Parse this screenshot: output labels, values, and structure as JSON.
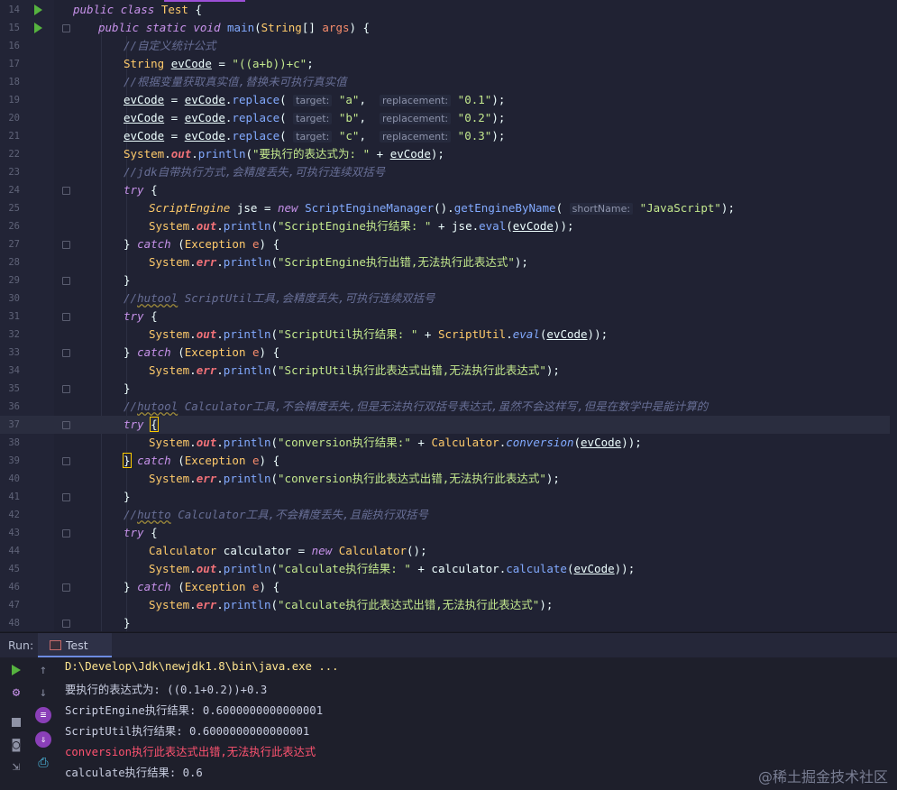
{
  "editor": {
    "lines": [
      {
        "n": "14",
        "run": true,
        "fold": false,
        "indent": 0,
        "tokens": [
          [
            "kw",
            "public "
          ],
          [
            "kw",
            "class "
          ],
          [
            "cls",
            "Test "
          ],
          [
            "plain",
            "{"
          ]
        ]
      },
      {
        "n": "15",
        "run": true,
        "fold": true,
        "indent": 1,
        "tokens": [
          [
            "kw",
            "public "
          ],
          [
            "kw",
            "static "
          ],
          [
            "kw",
            "void "
          ],
          [
            "fn",
            "main"
          ],
          [
            "plain",
            "("
          ],
          [
            "cls",
            "String"
          ],
          [
            "plain",
            "[] "
          ],
          [
            "param",
            "args"
          ],
          [
            "plain",
            ") {"
          ]
        ]
      },
      {
        "n": "16",
        "indent": 2,
        "tokens": [
          [
            "cmt",
            "//自定义统计公式"
          ]
        ]
      },
      {
        "n": "17",
        "indent": 2,
        "tokens": [
          [
            "cls",
            "String "
          ],
          [
            "var",
            "evCode"
          ],
          [
            "plain",
            " = "
          ],
          [
            "str",
            "\"((a+b))+c\""
          ],
          [
            "plain",
            ";"
          ]
        ]
      },
      {
        "n": "18",
        "indent": 2,
        "tokens": [
          [
            "cmt",
            "//根据变量获取真实值,替换未可执行真实值"
          ]
        ]
      },
      {
        "n": "19",
        "indent": 2,
        "tokens": [
          [
            "var",
            "evCode"
          ],
          [
            "plain",
            " = "
          ],
          [
            "var",
            "evCode"
          ],
          [
            "plain",
            "."
          ],
          [
            "fn",
            "replace"
          ],
          [
            "plain",
            "( "
          ],
          [
            "hint",
            "target:"
          ],
          [
            "plain",
            " "
          ],
          [
            "str",
            "\"a\""
          ],
          [
            "plain",
            ",  "
          ],
          [
            "hint",
            "replacement:"
          ],
          [
            "plain",
            " "
          ],
          [
            "str",
            "\"0.1\""
          ],
          [
            "plain",
            ");"
          ]
        ]
      },
      {
        "n": "20",
        "indent": 2,
        "tokens": [
          [
            "var",
            "evCode"
          ],
          [
            "plain",
            " = "
          ],
          [
            "var",
            "evCode"
          ],
          [
            "plain",
            "."
          ],
          [
            "fn",
            "replace"
          ],
          [
            "plain",
            "( "
          ],
          [
            "hint",
            "target:"
          ],
          [
            "plain",
            " "
          ],
          [
            "str",
            "\"b\""
          ],
          [
            "plain",
            ",  "
          ],
          [
            "hint",
            "replacement:"
          ],
          [
            "plain",
            " "
          ],
          [
            "str",
            "\"0.2\""
          ],
          [
            "plain",
            ");"
          ]
        ]
      },
      {
        "n": "21",
        "indent": 2,
        "tokens": [
          [
            "var",
            "evCode"
          ],
          [
            "plain",
            " = "
          ],
          [
            "var",
            "evCode"
          ],
          [
            "plain",
            "."
          ],
          [
            "fn",
            "replace"
          ],
          [
            "plain",
            "( "
          ],
          [
            "hint",
            "target:"
          ],
          [
            "plain",
            " "
          ],
          [
            "str",
            "\"c\""
          ],
          [
            "plain",
            ",  "
          ],
          [
            "hint",
            "replacement:"
          ],
          [
            "plain",
            " "
          ],
          [
            "str",
            "\"0.3\""
          ],
          [
            "plain",
            ");"
          ]
        ]
      },
      {
        "n": "22",
        "indent": 2,
        "tokens": [
          [
            "cls",
            "System"
          ],
          [
            "plain",
            "."
          ],
          [
            "fld",
            "out"
          ],
          [
            "plain",
            "."
          ],
          [
            "fn",
            "println"
          ],
          [
            "plain",
            "("
          ],
          [
            "str",
            "\"要执行的表达式为: \""
          ],
          [
            "plain",
            " + "
          ],
          [
            "var",
            "evCode"
          ],
          [
            "plain",
            ");"
          ]
        ]
      },
      {
        "n": "23",
        "indent": 2,
        "tokens": [
          [
            "cmt",
            "//jdk自带执行方式,会精度丢失,可执行连续双括号"
          ]
        ]
      },
      {
        "n": "24",
        "fold": true,
        "indent": 2,
        "tokens": [
          [
            "kw",
            "try "
          ],
          [
            "plain",
            "{"
          ]
        ]
      },
      {
        "n": "25",
        "indent": 3,
        "tokens": [
          [
            "clsi",
            "ScriptEngine "
          ],
          [
            "plain",
            "jse = "
          ],
          [
            "kw",
            "new "
          ],
          [
            "fn",
            "ScriptEngineManager"
          ],
          [
            "plain",
            "()."
          ],
          [
            "fn",
            "getEngineByName"
          ],
          [
            "plain",
            "( "
          ],
          [
            "hint",
            "shortName:"
          ],
          [
            "plain",
            " "
          ],
          [
            "str",
            "\"JavaScript\""
          ],
          [
            "plain",
            ");"
          ]
        ]
      },
      {
        "n": "26",
        "indent": 3,
        "tokens": [
          [
            "cls",
            "System"
          ],
          [
            "plain",
            "."
          ],
          [
            "fld",
            "out"
          ],
          [
            "plain",
            "."
          ],
          [
            "fn",
            "println"
          ],
          [
            "plain",
            "("
          ],
          [
            "str",
            "\"ScriptEngine执行结果: \""
          ],
          [
            "plain",
            " + jse."
          ],
          [
            "fn",
            "eval"
          ],
          [
            "plain",
            "("
          ],
          [
            "var",
            "evCode"
          ],
          [
            "plain",
            "));"
          ]
        ]
      },
      {
        "n": "27",
        "fold": true,
        "indent": 2,
        "tokens": [
          [
            "plain",
            "} "
          ],
          [
            "kw",
            "catch "
          ],
          [
            "plain",
            "("
          ],
          [
            "cls",
            "Exception "
          ],
          [
            "param",
            "e"
          ],
          [
            "plain",
            ") {"
          ]
        ]
      },
      {
        "n": "28",
        "indent": 3,
        "tokens": [
          [
            "cls",
            "System"
          ],
          [
            "plain",
            "."
          ],
          [
            "fld",
            "err"
          ],
          [
            "plain",
            "."
          ],
          [
            "fn",
            "println"
          ],
          [
            "plain",
            "("
          ],
          [
            "str",
            "\"ScriptEngine执行出错,无法执行此表达式\""
          ],
          [
            "plain",
            ");"
          ]
        ]
      },
      {
        "n": "29",
        "fold": true,
        "indent": 2,
        "tokens": [
          [
            "plain",
            "}"
          ]
        ]
      },
      {
        "n": "30",
        "indent": 2,
        "tokens": [
          [
            "cmt",
            "//"
          ],
          [
            "cmtw",
            "hutool"
          ],
          [
            "cmt",
            " ScriptUtil工具,会精度丢失,可执行连续双括号"
          ]
        ]
      },
      {
        "n": "31",
        "fold": true,
        "indent": 2,
        "tokens": [
          [
            "kw",
            "try "
          ],
          [
            "plain",
            "{"
          ]
        ]
      },
      {
        "n": "32",
        "indent": 3,
        "tokens": [
          [
            "cls",
            "System"
          ],
          [
            "plain",
            "."
          ],
          [
            "fld",
            "out"
          ],
          [
            "plain",
            "."
          ],
          [
            "fn",
            "println"
          ],
          [
            "plain",
            "("
          ],
          [
            "str",
            "\"ScriptUtil执行结果: \""
          ],
          [
            "plain",
            " + "
          ],
          [
            "cls",
            "ScriptUtil"
          ],
          [
            "plain",
            "."
          ],
          [
            "fni",
            "eval"
          ],
          [
            "plain",
            "("
          ],
          [
            "var",
            "evCode"
          ],
          [
            "plain",
            "));"
          ]
        ]
      },
      {
        "n": "33",
        "fold": true,
        "indent": 2,
        "tokens": [
          [
            "plain",
            "} "
          ],
          [
            "kw",
            "catch "
          ],
          [
            "plain",
            "("
          ],
          [
            "cls",
            "Exception "
          ],
          [
            "param",
            "e"
          ],
          [
            "plain",
            ") {"
          ]
        ]
      },
      {
        "n": "34",
        "indent": 3,
        "tokens": [
          [
            "cls",
            "System"
          ],
          [
            "plain",
            "."
          ],
          [
            "fld",
            "err"
          ],
          [
            "plain",
            "."
          ],
          [
            "fn",
            "println"
          ],
          [
            "plain",
            "("
          ],
          [
            "str",
            "\"ScriptUtil执行此表达式出错,无法执行此表达式\""
          ],
          [
            "plain",
            ");"
          ]
        ]
      },
      {
        "n": "35",
        "fold": true,
        "indent": 2,
        "tokens": [
          [
            "plain",
            "}"
          ]
        ]
      },
      {
        "n": "36",
        "indent": 2,
        "tokens": [
          [
            "cmt",
            "//"
          ],
          [
            "cmtw",
            "hutool"
          ],
          [
            "cmt",
            " Calculator工具,不会精度丢失,但是无法执行双括号表达式,虽然不会这样写,但是在数学中是能计算的"
          ]
        ]
      },
      {
        "n": "37",
        "fold": true,
        "indent": 2,
        "cur": true,
        "tokens": [
          [
            "kw",
            "try "
          ],
          [
            "curbrace",
            "{"
          ]
        ]
      },
      {
        "n": "38",
        "indent": 3,
        "tokens": [
          [
            "cls",
            "System"
          ],
          [
            "plain",
            "."
          ],
          [
            "fld",
            "out"
          ],
          [
            "plain",
            "."
          ],
          [
            "fn",
            "println"
          ],
          [
            "plain",
            "("
          ],
          [
            "str",
            "\"conversion执行结果:\""
          ],
          [
            "plain",
            " + "
          ],
          [
            "cls",
            "Calculator"
          ],
          [
            "plain",
            "."
          ],
          [
            "fni",
            "conversion"
          ],
          [
            "plain",
            "("
          ],
          [
            "var",
            "evCode"
          ],
          [
            "plain",
            "));"
          ]
        ]
      },
      {
        "n": "39",
        "fold": true,
        "indent": 2,
        "tokens": [
          [
            "curbrace",
            "}"
          ],
          [
            "plain",
            " "
          ],
          [
            "kw",
            "catch "
          ],
          [
            "plain",
            "("
          ],
          [
            "cls",
            "Exception "
          ],
          [
            "param",
            "e"
          ],
          [
            "plain",
            ") {"
          ]
        ]
      },
      {
        "n": "40",
        "indent": 3,
        "tokens": [
          [
            "cls",
            "System"
          ],
          [
            "plain",
            "."
          ],
          [
            "fld",
            "err"
          ],
          [
            "plain",
            "."
          ],
          [
            "fn",
            "println"
          ],
          [
            "plain",
            "("
          ],
          [
            "str",
            "\"conversion执行此表达式出错,无法执行此表达式\""
          ],
          [
            "plain",
            ");"
          ]
        ]
      },
      {
        "n": "41",
        "fold": true,
        "indent": 2,
        "tokens": [
          [
            "plain",
            "}"
          ]
        ]
      },
      {
        "n": "42",
        "indent": 2,
        "tokens": [
          [
            "cmt",
            "//"
          ],
          [
            "cmtw",
            "hutto"
          ],
          [
            "cmt",
            " Calculator工具,不会精度丢失,且能执行双括号"
          ]
        ]
      },
      {
        "n": "43",
        "fold": true,
        "indent": 2,
        "tokens": [
          [
            "kw",
            "try "
          ],
          [
            "plain",
            "{"
          ]
        ]
      },
      {
        "n": "44",
        "indent": 3,
        "tokens": [
          [
            "cls",
            "Calculator "
          ],
          [
            "plain",
            "calculator = "
          ],
          [
            "kw",
            "new "
          ],
          [
            "cls",
            "Calculator"
          ],
          [
            "plain",
            "();"
          ]
        ]
      },
      {
        "n": "45",
        "indent": 3,
        "tokens": [
          [
            "cls",
            "System"
          ],
          [
            "plain",
            "."
          ],
          [
            "fld",
            "out"
          ],
          [
            "plain",
            "."
          ],
          [
            "fn",
            "println"
          ],
          [
            "plain",
            "("
          ],
          [
            "str",
            "\"calculate执行结果: \""
          ],
          [
            "plain",
            " + calculator."
          ],
          [
            "fn",
            "calculate"
          ],
          [
            "plain",
            "("
          ],
          [
            "var",
            "evCode"
          ],
          [
            "plain",
            "));"
          ]
        ]
      },
      {
        "n": "46",
        "fold": true,
        "indent": 2,
        "tokens": [
          [
            "plain",
            "} "
          ],
          [
            "kw",
            "catch "
          ],
          [
            "plain",
            "("
          ],
          [
            "cls",
            "Exception "
          ],
          [
            "param",
            "e"
          ],
          [
            "plain",
            ") {"
          ]
        ]
      },
      {
        "n": "47",
        "indent": 3,
        "tokens": [
          [
            "cls",
            "System"
          ],
          [
            "plain",
            "."
          ],
          [
            "fld",
            "err"
          ],
          [
            "plain",
            "."
          ],
          [
            "fn",
            "println"
          ],
          [
            "plain",
            "("
          ],
          [
            "str",
            "\"calculate执行此表达式出错,无法执行此表达式\""
          ],
          [
            "plain",
            ");"
          ]
        ]
      },
      {
        "n": "48",
        "fold": true,
        "indent": 2,
        "tokens": [
          [
            "plain",
            "}"
          ]
        ]
      }
    ]
  },
  "runbar": {
    "label": "Run:",
    "tab": "Test"
  },
  "console": {
    "lines": [
      {
        "kind": "path",
        "text": "D:\\Develop\\Jdk\\newjdk1.8\\bin\\java.exe ..."
      },
      {
        "kind": "out",
        "text": "要执行的表达式为: ((0.1+0.2))+0.3"
      },
      {
        "kind": "out",
        "text": "ScriptEngine执行结果: 0.6000000000000001"
      },
      {
        "kind": "out",
        "text": "ScriptUtil执行结果: 0.6000000000000001"
      },
      {
        "kind": "err",
        "text": "conversion执行此表达式出错,无法执行此表达式"
      },
      {
        "kind": "out",
        "text": "calculate执行结果: 0.6"
      }
    ]
  },
  "watermark": "@稀土掘金技术社区",
  "colors": {
    "accent": "#6c8be0",
    "run_green": "#56b33f",
    "error_red": "#ff5370",
    "path_yellow": "#ffe58f"
  }
}
